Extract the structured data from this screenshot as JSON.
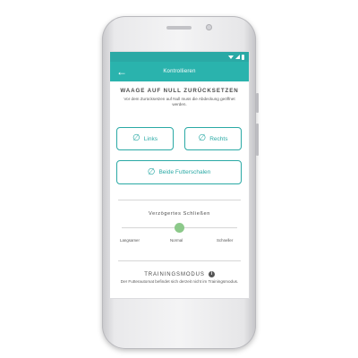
{
  "header": {
    "title": "Kontrollieren",
    "back_icon": "arrow-left-icon"
  },
  "tare": {
    "title": "WAAGE AUF NULL ZURÜCKSETZEN",
    "description": "Vor dem Zurücksetzen auf Null muss die Abdeckung geöffnet werden.",
    "buttons": [
      {
        "label": "Links",
        "icon": "empty-set-icon"
      },
      {
        "label": "Rechts",
        "icon": "empty-set-icon"
      },
      {
        "label": "Beide Futterschalen",
        "icon": "empty-set-icon"
      }
    ]
  },
  "delayed_close": {
    "title": "Verzögertes Schließen",
    "options": [
      "Langsamer",
      "Normal",
      "Schneller"
    ],
    "selected": "Normal",
    "level": 0.5
  },
  "training": {
    "title": "TRAININGSMODUS",
    "description": "Der Futterautomat befindet sich derzeit nicht im Trainingsmodus."
  },
  "colors": {
    "accent": "#2aa9a5",
    "knob": "#8cc98a"
  }
}
